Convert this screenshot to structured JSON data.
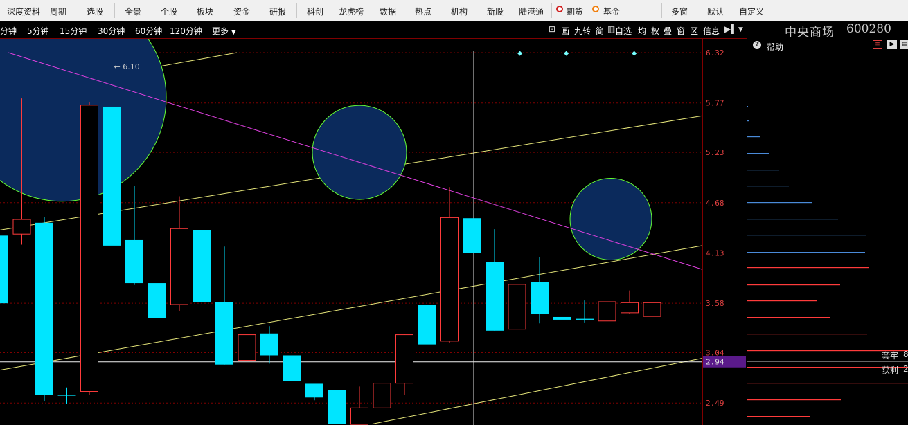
{
  "menu": {
    "items": [
      "深度资料",
      "周期",
      "选股",
      "全景",
      "个股",
      "板块",
      "资金",
      "研报",
      "科创",
      "龙虎榜",
      "数据",
      "热点",
      "机构",
      "新股",
      "陆港通",
      "期货",
      "基金",
      "多窗",
      "默认",
      "自定义"
    ]
  },
  "toolbar": {
    "periods": [
      "分钟",
      "5分钟",
      "15分钟",
      "30分钟",
      "60分钟",
      "120分钟"
    ],
    "more_label": "更多",
    "right_items": [
      "画",
      "九转",
      "简",
      "自选",
      "均",
      "权",
      "叠",
      "窗",
      "区",
      "信息"
    ]
  },
  "stock": {
    "name": "中央商场",
    "code": "600280"
  },
  "side": {
    "help_label": "帮助",
    "trapped_label": "套牢",
    "trapped_value": "8",
    "profit_label": "获利",
    "profit_value": "2"
  },
  "colors": {
    "up": "#ff3b3b",
    "down": "#00e5ff",
    "circle_fill": "#0b2a5c",
    "circle_edge": "#66ff33",
    "trend_line": "#e6e67a",
    "diag_line": "#e040e0",
    "axis_text": "#e04040",
    "grid": "#800000"
  },
  "chart_data": {
    "type": "candlestick",
    "y_ticks": [
      6.32,
      5.77,
      5.23,
      4.68,
      4.13,
      3.58,
      3.04,
      2.49
    ],
    "current_price_label": "2.94",
    "current_price": 2.94,
    "high_marker_label": "6.10",
    "candles": [
      {
        "o": 4.32,
        "c": 3.58,
        "h": 4.42,
        "l": 3.58
      },
      {
        "o": 4.34,
        "c": 4.5,
        "h": 5.82,
        "l": 4.22
      },
      {
        "o": 4.46,
        "c": 2.58,
        "h": 4.52,
        "l": 2.51
      },
      {
        "o": 2.58,
        "c": 2.57,
        "h": 2.66,
        "l": 2.48
      },
      {
        "o": 2.62,
        "c": 5.75,
        "h": 5.78,
        "l": 2.58
      },
      {
        "o": 5.73,
        "c": 4.21,
        "h": 6.1,
        "l": 4.08
      },
      {
        "o": 4.27,
        "c": 3.8,
        "h": 4.86,
        "l": 3.78
      },
      {
        "o": 3.8,
        "c": 3.42,
        "h": 3.8,
        "l": 3.35
      },
      {
        "o": 3.57,
        "c": 4.4,
        "h": 4.75,
        "l": 3.49
      },
      {
        "o": 4.38,
        "c": 3.59,
        "h": 4.6,
        "l": 3.53
      },
      {
        "o": 3.59,
        "c": 2.91,
        "h": 4.2,
        "l": 2.91
      },
      {
        "o": 2.96,
        "c": 3.24,
        "h": 3.62,
        "l": 2.35
      },
      {
        "o": 3.25,
        "c": 3.01,
        "h": 3.33,
        "l": 2.92
      },
      {
        "o": 3.01,
        "c": 2.73,
        "h": 3.18,
        "l": 2.56
      },
      {
        "o": 2.7,
        "c": 2.55,
        "h": 2.7,
        "l": 2.52
      },
      {
        "o": 2.63,
        "c": 2.26,
        "h": 2.63,
        "l": 2.26
      },
      {
        "o": 2.26,
        "c": 2.44,
        "h": 2.67,
        "l": 2.26
      },
      {
        "o": 2.44,
        "c": 2.71,
        "h": 3.79,
        "l": 2.44
      },
      {
        "o": 2.71,
        "c": 3.24,
        "h": 3.24,
        "l": 2.58
      },
      {
        "o": 3.56,
        "c": 3.13,
        "h": 3.57,
        "l": 2.81
      },
      {
        "o": 3.17,
        "c": 4.52,
        "h": 4.85,
        "l": 3.15
      },
      {
        "o": 4.51,
        "c": 4.13,
        "h": 5.7,
        "l": 2.36
      },
      {
        "o": 4.03,
        "c": 3.28,
        "h": 4.39,
        "l": 3.28
      },
      {
        "o": 3.3,
        "c": 3.79,
        "h": 4.17,
        "l": 3.25
      },
      {
        "o": 3.81,
        "c": 3.46,
        "h": 4.08,
        "l": 3.36
      },
      {
        "o": 3.43,
        "c": 3.4,
        "h": 3.92,
        "l": 3.12
      },
      {
        "o": 3.41,
        "c": 3.4,
        "h": 3.61,
        "l": 3.37
      },
      {
        "o": 3.39,
        "c": 3.6,
        "h": 3.89,
        "l": 3.36
      },
      {
        "o": 3.48,
        "c": 3.59,
        "h": 3.72,
        "l": 3.46
      },
      {
        "o": 3.44,
        "c": 3.59,
        "h": 3.69,
        "l": 3.43
      }
    ]
  }
}
